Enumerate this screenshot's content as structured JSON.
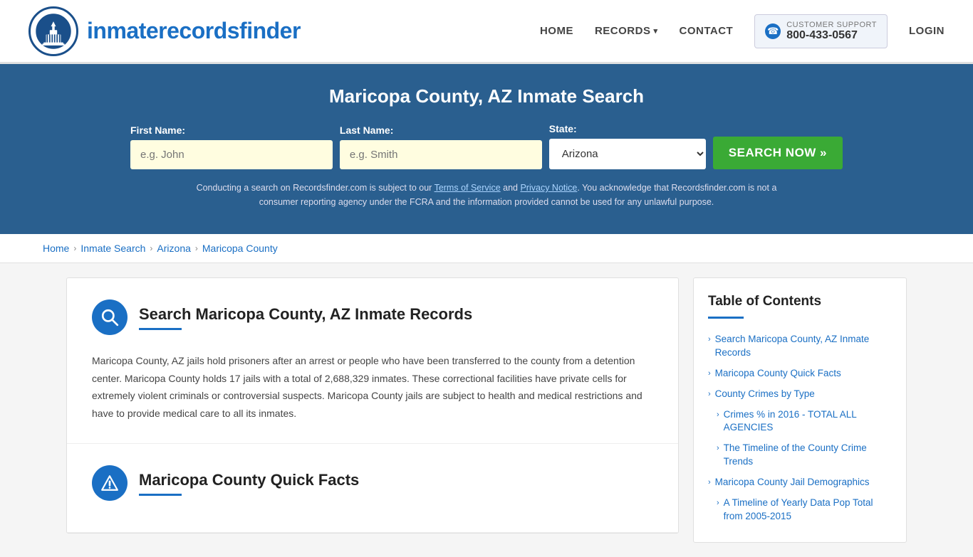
{
  "header": {
    "logo_text_plain": "inmaterecords",
    "logo_text_bold": "finder",
    "nav": {
      "home": "HOME",
      "records": "RECORDS",
      "contact": "CONTACT",
      "support_label": "CUSTOMER SUPPORT",
      "support_phone": "800-433-0567",
      "login": "LOGIN"
    }
  },
  "hero": {
    "title": "Maricopa County, AZ Inmate Search",
    "first_name_label": "First Name:",
    "first_name_placeholder": "e.g. John",
    "last_name_label": "Last Name:",
    "last_name_placeholder": "e.g. Smith",
    "state_label": "State:",
    "state_value": "Arizona",
    "search_btn": "SEARCH NOW »",
    "disclaimer": "Conducting a search on Recordsfinder.com is subject to our Terms of Service and Privacy Notice. You acknowledge that Recordsfinder.com is not a consumer reporting agency under the FCRA and the information provided cannot be used for any unlawful purpose.",
    "terms_link": "Terms of Service",
    "privacy_link": "Privacy Notice"
  },
  "breadcrumb": {
    "home": "Home",
    "inmate_search": "Inmate Search",
    "arizona": "Arizona",
    "county": "Maricopa County"
  },
  "main": {
    "section1": {
      "title": "Search Maricopa County, AZ Inmate Records",
      "body": "Maricopa County, AZ jails hold prisoners after an arrest or people who have been transferred to the county from a detention center. Maricopa County holds 17 jails with a total of 2,688,329 inmates. These correctional facilities have private cells for extremely violent criminals or controversial suspects. Maricopa County jails are subject to health and medical restrictions and have to provide medical care to all its inmates."
    },
    "section2": {
      "title": "Maricopa County Quick Facts"
    }
  },
  "toc": {
    "title": "Table of Contents",
    "items": [
      {
        "label": "Search Maricopa County, AZ Inmate Records",
        "sub": false
      },
      {
        "label": "Maricopa County Quick Facts",
        "sub": false
      },
      {
        "label": "County Crimes by Type",
        "sub": false
      },
      {
        "label": "Crimes % in 2016 - TOTAL ALL AGENCIES",
        "sub": true
      },
      {
        "label": "The Timeline of the County Crime Trends",
        "sub": true
      },
      {
        "label": "Maricopa County Jail Demographics",
        "sub": false
      },
      {
        "label": "A Timeline of Yearly Data Pop Total from 2005-2015",
        "sub": true
      }
    ]
  }
}
